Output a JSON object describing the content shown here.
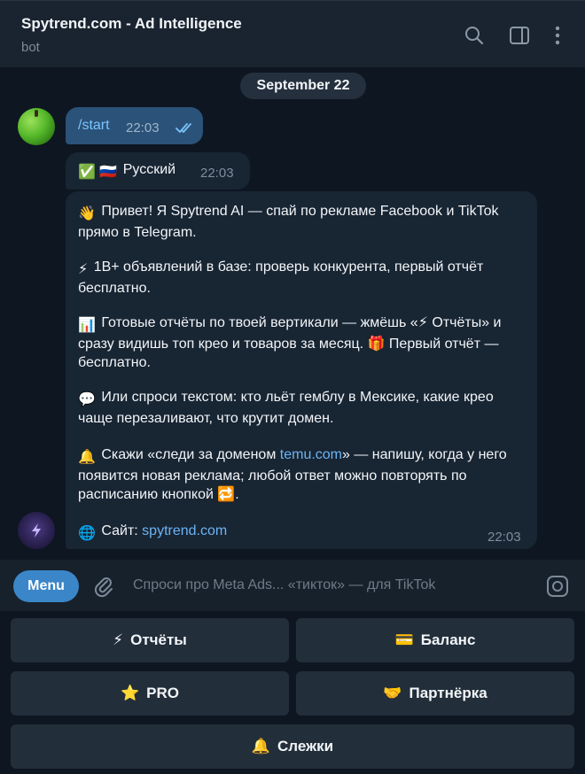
{
  "header": {
    "title": "Spytrend.com - Ad Intelligence",
    "subtitle": "bot",
    "icons": [
      "search-icon",
      "sidebar-toggle-icon",
      "more-vert-icon"
    ]
  },
  "chat": {
    "date": "September 22",
    "outgoing": {
      "text": "/start",
      "time": "22:03",
      "status": "read"
    },
    "language_msg": {
      "emoji": "✅ 🇷🇺",
      "text": "Русский",
      "time": "22:03"
    },
    "welcome": {
      "p1": {
        "emoji": "👋",
        "text": "Привет! Я Spytrend AI — спай по рекламе Facebook и TikTok прямо в Telegram."
      },
      "p2": {
        "emoji": "⚡",
        "text": "1B+ объявлений в базе: проверь конкурента, первый отчёт бесплатно."
      },
      "p3": {
        "emoji": "📊",
        "text_a": "Готовые отчёты по твоей вертикали — жмёшь «",
        "inline_emoji": "⚡",
        "text_b": " Отчёты» и сразу видишь топ крео и товаров за месяц.",
        "gift_emoji": "🎁",
        "text_c": " Первый отчёт — бесплатно."
      },
      "p4": {
        "emoji": "💬",
        "text": "Или спроси текстом: кто льёт гемблу в Мексике, какие крео чаще перезаливают, что крутит домен."
      },
      "p5": {
        "emoji": "🔔",
        "text_a": "Скажи «следи за доменом ",
        "link": "temu.com",
        "text_b": "» — напишу, когда у него появится новая реклама; любой ответ можно повторять по расписанию кнопкой ",
        "repeat_emoji": "🔁",
        "text_c": "."
      },
      "p6": {
        "emoji": "🌐",
        "label": "Сайт: ",
        "link": "spytrend.com"
      },
      "time": "22:03"
    }
  },
  "composer": {
    "menu_label": "Menu",
    "placeholder": "Спроси про Meta Ads... «тикток» — для TikTok"
  },
  "keyboard": [
    {
      "emoji": "⚡",
      "label": "Отчёты"
    },
    {
      "emoji": "💳",
      "label": "Баланс"
    },
    {
      "emoji": "⭐",
      "label": "PRO"
    },
    {
      "emoji": "🤝",
      "label": "Партнёрка"
    },
    {
      "emoji": "🔔",
      "label": "Слежки"
    }
  ],
  "colors": {
    "background": "#0e1621",
    "header": "#1a2430",
    "outgoing_bubble": "#2b5278",
    "incoming_bubble": "#182533",
    "accent": "#3a86c8",
    "link": "#6cb4f5"
  }
}
